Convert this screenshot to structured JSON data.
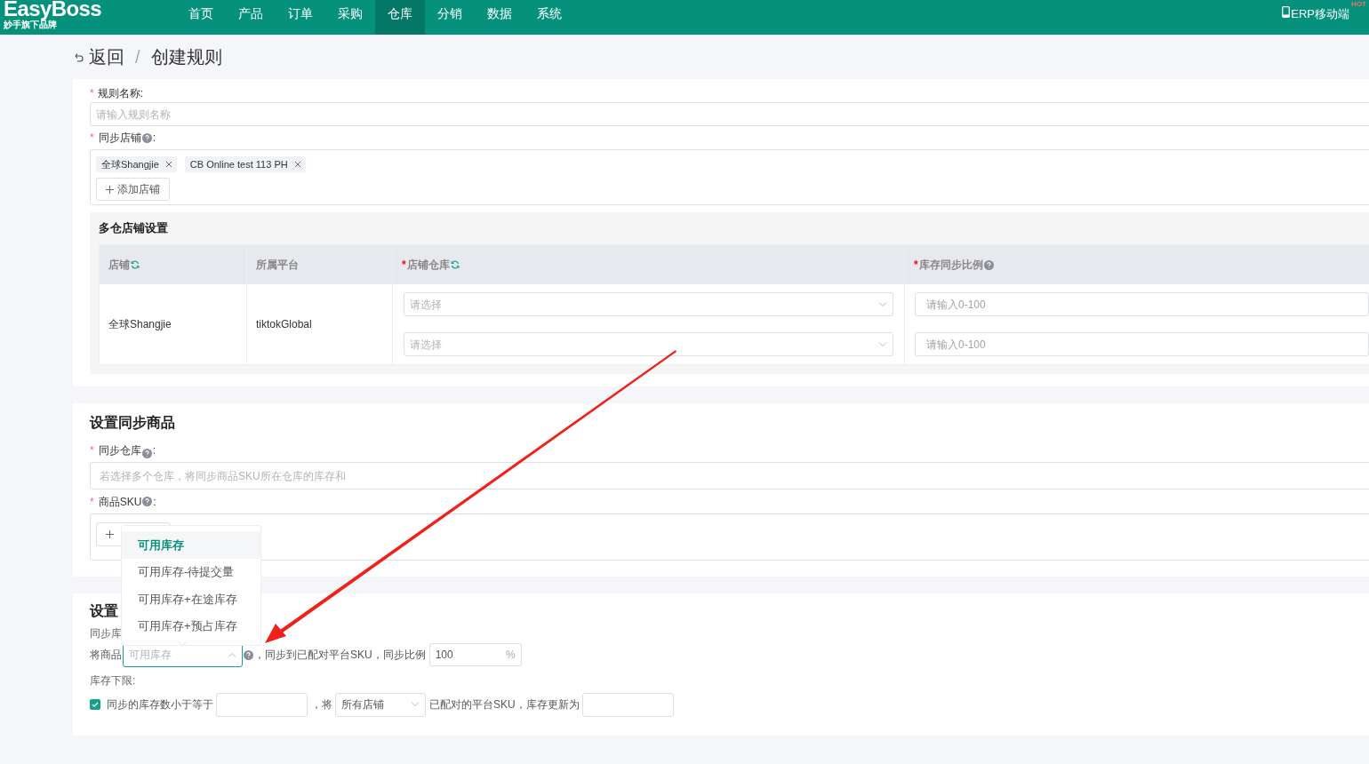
{
  "header": {
    "logo": "EasyBoss",
    "logo_sub": "妙手旗下品牌",
    "nav": [
      {
        "label": "首页",
        "selected": false
      },
      {
        "label": "产品",
        "selected": false
      },
      {
        "label": "订单",
        "selected": false
      },
      {
        "label": "采购",
        "selected": false
      },
      {
        "label": "仓库",
        "selected": true
      },
      {
        "label": "分销",
        "selected": false
      },
      {
        "label": "数据",
        "selected": false
      },
      {
        "label": "系统",
        "selected": false
      }
    ],
    "mobile": "ERP移动端",
    "hot": "HOT"
  },
  "breadcrumb": {
    "back": "返回",
    "separator": "/",
    "current": "创建规则"
  },
  "rule_section": {
    "name_mark": "*",
    "name_label": "规则名称:",
    "name_placeholder": "请输入规则名称",
    "shops_mark": "*",
    "shops_label": "同步店铺",
    "shops_colon": ":",
    "shops": [
      {
        "label": "全球Shangjie"
      },
      {
        "label": "CB Online test 113 PH"
      }
    ],
    "add_shop": "添加店铺",
    "multi_title": "多仓店铺设置",
    "columns": [
      {
        "label": "店铺",
        "kind": "sync"
      },
      {
        "label": "所属平台",
        "kind": "plain"
      },
      {
        "mark": "*",
        "label": "店铺仓库",
        "kind": "sync"
      },
      {
        "mark": "*",
        "label": "库存同步比例",
        "kind": "help"
      }
    ],
    "rows": [
      {
        "shop": "全球Shangjie",
        "platform": "tiktokGlobal",
        "warehouses": [
          {
            "placeholder": "请选择",
            "ratio_placeholder": "请输入0-100"
          },
          {
            "placeholder": "请选择",
            "ratio_placeholder": "请输入0-100"
          }
        ]
      }
    ]
  },
  "goods_section": {
    "title": "设置同步商品",
    "warehouse_mark": "*",
    "warehouse_label": "同步仓库",
    "warehouse_colon": ":",
    "warehouse_placeholder": "若选择多个仓库，将同步商品SKU所在仓库的库存和",
    "sku_mark": "*",
    "sku_label": "商品SKU",
    "sku_colon": ":"
  },
  "sync_section": {
    "title": "设置",
    "stock_label": "同步库",
    "prefix": "将商品",
    "stock_select": "可用库存",
    "middle": "，同步到已配对平台SKU，同步比例",
    "ratio": "100",
    "unit": "%",
    "lower_label": "库存下限:",
    "lower_checked": true,
    "lower_text": "同步的库存数小于等于",
    "lower_mid": "，将",
    "shop_select": "所有店铺",
    "lower_end": "已配对的平台SKU，库存更新为"
  },
  "dropdown": [
    {
      "label": "可用库存",
      "selected": true
    },
    {
      "label": "可用库存-待提交量",
      "selected": false
    },
    {
      "label": "可用库存+在途库存",
      "selected": false
    },
    {
      "label": "可用库存+预占库存",
      "selected": false
    }
  ]
}
